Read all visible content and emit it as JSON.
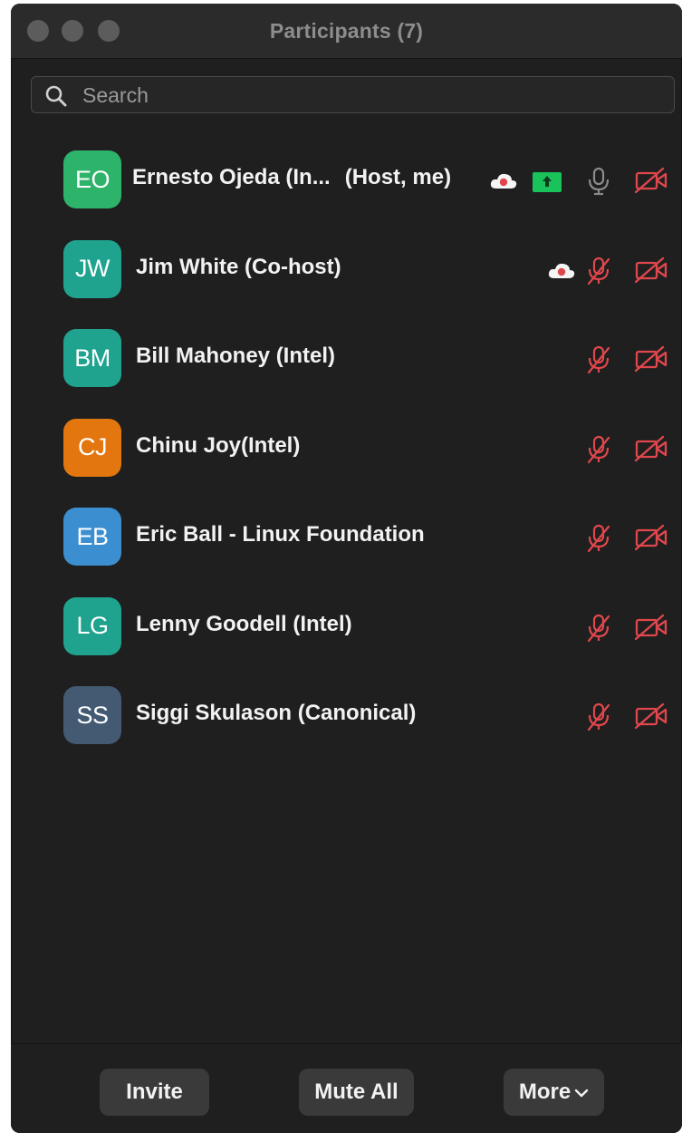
{
  "window": {
    "title": "Participants (7)"
  },
  "search": {
    "placeholder": "Search",
    "value": ""
  },
  "participants": [
    {
      "initials": "EO",
      "name": "Ernesto Ojeda (In...",
      "role": "(Host, me)",
      "avatar_color": "#2db36a",
      "muted": false,
      "video_off": true,
      "recording": true,
      "sharing": true
    },
    {
      "initials": "JW",
      "name": "Jim White (Co-host)",
      "role": "",
      "avatar_color": "#1fa38e",
      "muted": true,
      "video_off": true,
      "recording": true,
      "sharing": false
    },
    {
      "initials": "BM",
      "name": "Bill Mahoney (Intel)",
      "role": "",
      "avatar_color": "#1fa38e",
      "muted": true,
      "video_off": true,
      "recording": false,
      "sharing": false
    },
    {
      "initials": "CJ",
      "name": "Chinu Joy(Intel)",
      "role": "",
      "avatar_color": "#e3760f",
      "muted": true,
      "video_off": true,
      "recording": false,
      "sharing": false
    },
    {
      "initials": "EB",
      "name": "Eric Ball - Linux Foundation",
      "role": "",
      "avatar_color": "#3b8fd0",
      "muted": true,
      "video_off": true,
      "recording": false,
      "sharing": false
    },
    {
      "initials": "LG",
      "name": "Lenny Goodell (Intel)",
      "role": "",
      "avatar_color": "#1fa38e",
      "muted": true,
      "video_off": true,
      "recording": false,
      "sharing": false
    },
    {
      "initials": "SS",
      "name": "Siggi Skulason (Canonical)",
      "role": "",
      "avatar_color": "#435a72",
      "muted": true,
      "video_off": true,
      "recording": false,
      "sharing": false
    }
  ],
  "footer": {
    "invite_label": "Invite",
    "mute_all_label": "Mute All",
    "more_label": "More"
  },
  "colors": {
    "muted_red": "#e0474c",
    "share_green": "#19c35a",
    "mic_gray": "#8a8a8a"
  }
}
